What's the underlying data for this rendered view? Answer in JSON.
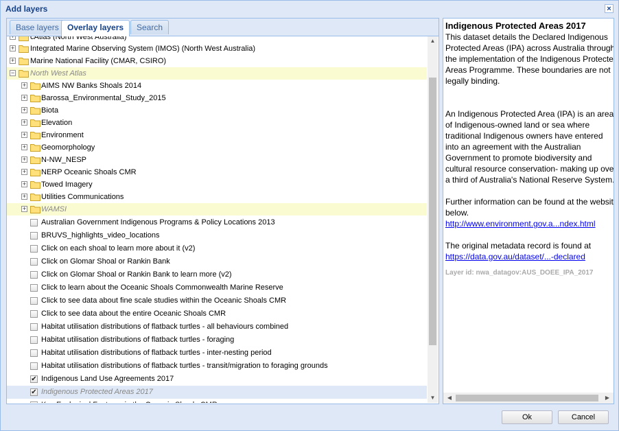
{
  "dialog": {
    "title": "Add layers",
    "close_glyph": "×"
  },
  "tabs": [
    {
      "label": "Base layers",
      "active": false
    },
    {
      "label": "Overlay layers",
      "active": true
    },
    {
      "label": "Search",
      "active": false
    }
  ],
  "tree": {
    "partial_top_item": "cAtlas (North West Australia)",
    "folders_top": [
      {
        "label": "Integrated Marine Observing System (IMOS) (North West Australia)"
      },
      {
        "label": "Marine National Facility (CMAR, CSIRO)"
      }
    ],
    "open_folder": {
      "label": "North West Atlas",
      "expander": "−"
    },
    "subfolders": [
      "AIMS NW Banks Shoals 2014",
      "Barossa_Environmental_Study_2015",
      "Biota",
      "Elevation",
      "Environment",
      "Geomorphology",
      "N-NW_NESP",
      "NERP Oceanic Shoals CMR",
      "Towed Imagery",
      "Utilities Communications",
      "WAMSI"
    ],
    "expander_plus": "+",
    "layers": [
      {
        "label": "Australian Government Indigenous Programs & Policy Locations 2013",
        "checked": false
      },
      {
        "label": "BRUVS_highlights_video_locations",
        "checked": false
      },
      {
        "label": "Click on each shoal to learn more about it (v2)",
        "checked": false
      },
      {
        "label": "Click on Glomar Shoal or Rankin Bank",
        "checked": false
      },
      {
        "label": "Click on Glomar Shoal or Rankin Bank to learn more (v2)",
        "checked": false
      },
      {
        "label": "Click to learn about the Oceanic Shoals Commonwealth Marine Reserve",
        "checked": false
      },
      {
        "label": "Click to see data about fine scale studies within the Oceanic Shoals CMR",
        "checked": false
      },
      {
        "label": "Click to see data about the entire Oceanic Shoals CMR",
        "checked": false
      },
      {
        "label": "Habitat utilisation distributions of flatback turtles - all behaviours combined",
        "checked": false
      },
      {
        "label": "Habitat utilisation distributions of flatback turtles - foraging",
        "checked": false
      },
      {
        "label": "Habitat utilisation distributions of flatback turtles - inter-nesting period",
        "checked": false
      },
      {
        "label": "Habitat utilisation distributions of flatback turtles - transit/migration to foraging grounds",
        "checked": false
      },
      {
        "label": "Indigenous Land Use Agreements 2017",
        "checked": true
      },
      {
        "label": "Indigenous Protected Areas 2017",
        "checked": true
      },
      {
        "label": "Key Ecological Features in the Oceanic Shoals CMR",
        "checked": false
      }
    ],
    "check_glyph": "✔"
  },
  "info_panel": {
    "title": "Indigenous Protected Areas 2017",
    "para1": "This dataset details the Declared Indigenous Protected Areas (IPA) across Australia through the implementation of the Indigenous Protected Areas Programme. These boundaries are not legally binding.",
    "para2": "An Indigenous Protected Area (IPA) is an area of Indigenous-owned land or sea where traditional Indigenous owners have entered into an agreement with the Australian Government to promote biodiversity and cultural resource conservation- making up over a third of Australia's National Reserve System.",
    "para3": "Further information can be found at the website below.",
    "link1": "http://www.environment.gov.a...ndex.html",
    "para4": "The original metadata record is found at",
    "link2": "https://data.gov.au/dataset/...-declared",
    "layer_id": "Layer id: nwa_datagov:AUS_DOEE_IPA_2017"
  },
  "scroll_glyphs": {
    "up": "▲",
    "down": "▼",
    "left": "◀",
    "right": "▶"
  },
  "buttons": {
    "ok": "Ok",
    "cancel": "Cancel"
  }
}
